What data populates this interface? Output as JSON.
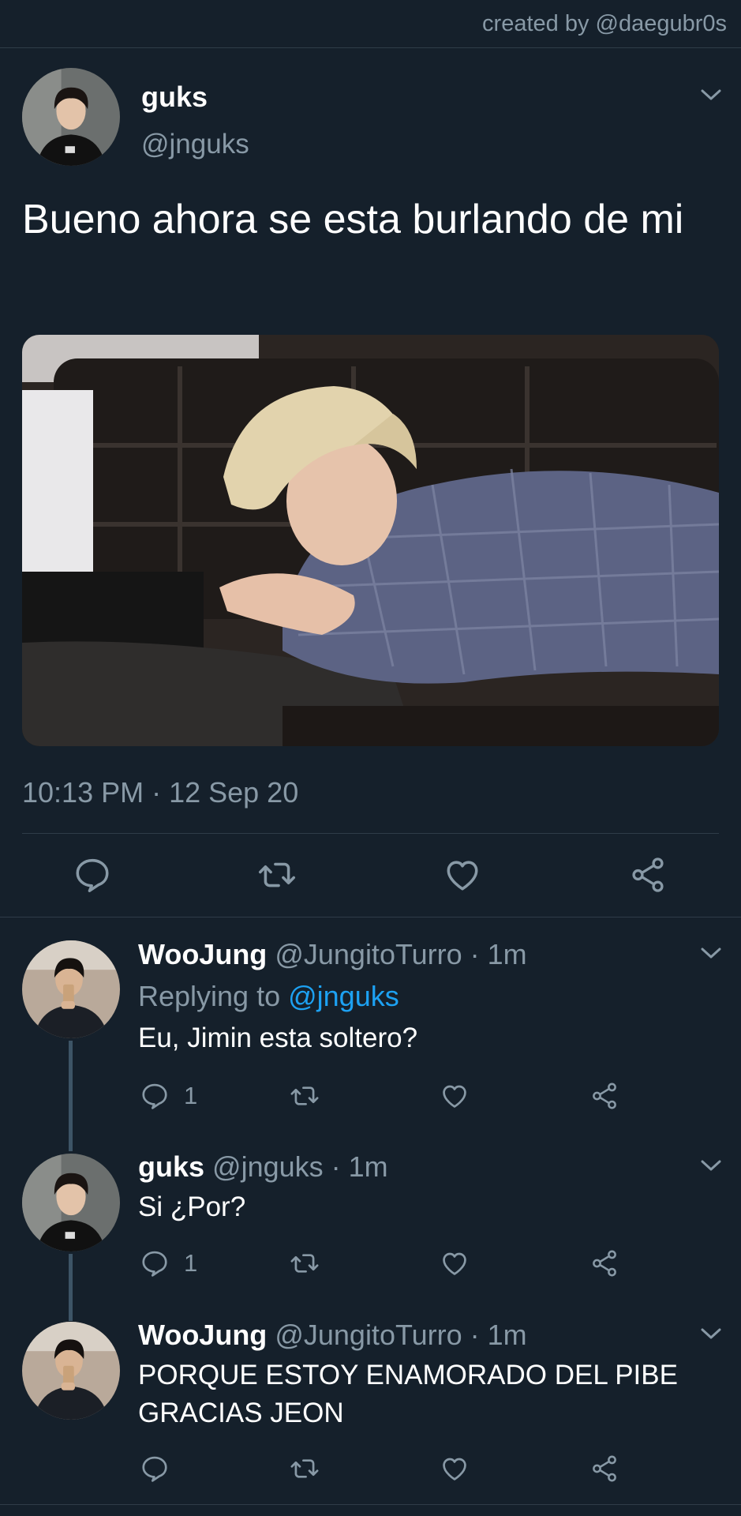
{
  "watermark": "created by @daegubr0s",
  "main_tweet": {
    "name": "guks",
    "handle": "@jnguks",
    "text": "Bueno ahora se esta burlando de mi",
    "timestamp": "10:13 PM · 12 Sep 20",
    "actions": [
      "reply-icon",
      "retweet-icon",
      "like-icon",
      "share-icon"
    ]
  },
  "replies": [
    {
      "name": "WooJung",
      "meta": "@JungitoTurro · 1m",
      "replying_prefix": "Replying to ",
      "replying_mention": "@jnguks",
      "text": "Eu, Jimin esta soltero?",
      "reply_count": "1"
    },
    {
      "name": "guks",
      "meta": "@jnguks · 1m",
      "text": "Si ¿Por?",
      "reply_count": "1"
    },
    {
      "name": "WooJung",
      "meta": "@JungitoTurro · 1m",
      "text": "PORQUE ESTOY ENAMORADO DEL PIBE GRACIAS JEON",
      "reply_count": ""
    }
  ],
  "colors": {
    "background": "#15202b",
    "secondary_text": "#8899a6",
    "link": "#1da1f2",
    "divider": "#2f3c48",
    "thread_line": "#3d5466"
  }
}
